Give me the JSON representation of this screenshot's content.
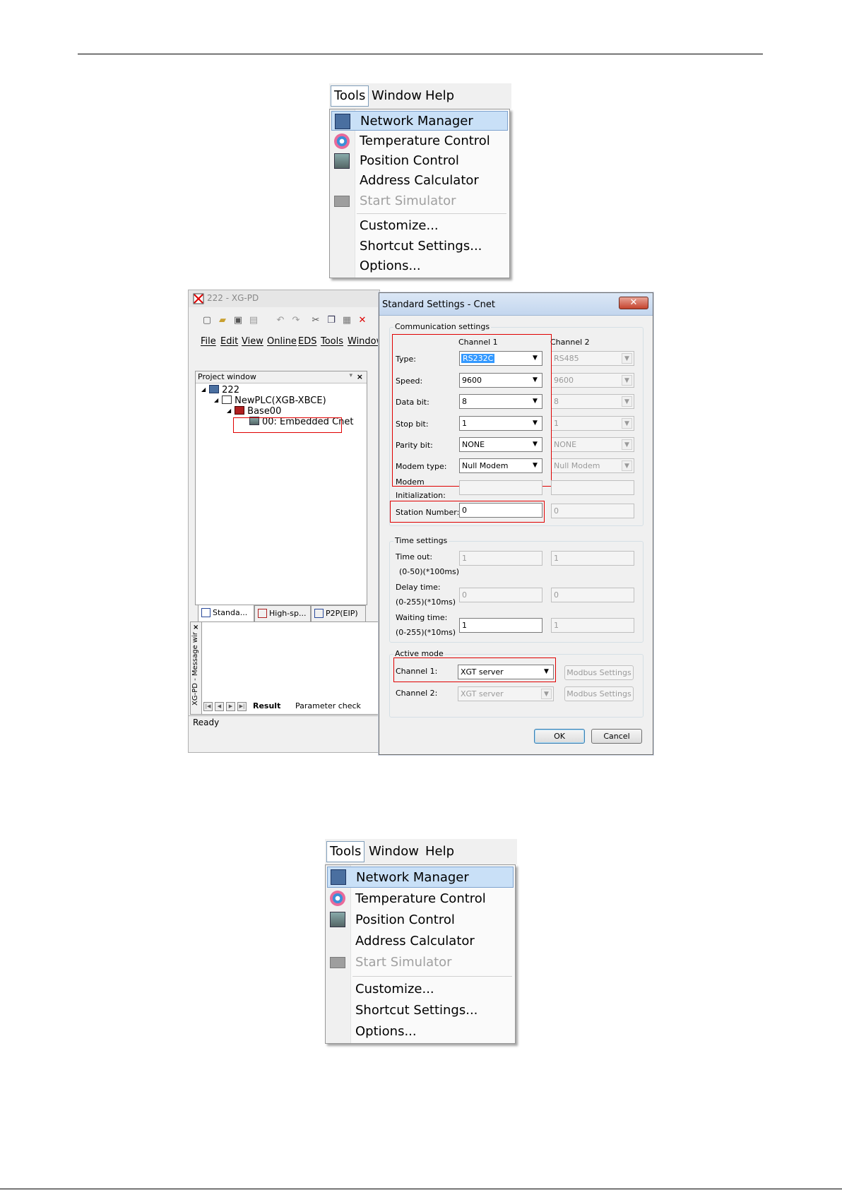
{
  "menu_top": {
    "bar": [
      "Tools",
      "Window",
      "Help"
    ],
    "items": [
      "Network Manager",
      "Temperature Control",
      "Position Control",
      "Address Calculator",
      "Start Simulator",
      "Customize...",
      "Shortcut Settings...",
      "Options..."
    ]
  },
  "menu_bottom": {
    "bar": [
      "Tools",
      "Window",
      "Help"
    ],
    "items": [
      "Network Manager",
      "Temperature Control",
      "Position Control",
      "Address Calculator",
      "Start Simulator",
      "Customize...",
      "Shortcut Settings...",
      "Options..."
    ]
  },
  "xgpd": {
    "title": "222 - XG-PD",
    "menu": [
      "File",
      "Edit",
      "View",
      "Online",
      "EDS",
      "Tools",
      "Window"
    ],
    "project_window": "Project window",
    "tree": [
      "222",
      "NewPLC(XGB-XBCE)",
      "Base00",
      "00: Embedded Cnet"
    ],
    "tabs": [
      "Standa...",
      "High-sp...",
      "P2P(EIP)"
    ],
    "message_window": "XG-PD - Message wir",
    "bottom_tabs": [
      "Result",
      "Parameter check"
    ],
    "status": "Ready"
  },
  "dialog": {
    "title": "Standard Settings - Cnet",
    "comm_group": "Communication settings",
    "channel1": "Channel 1",
    "channel2": "Channel 2",
    "labels": {
      "type": "Type:",
      "speed": "Speed:",
      "data_bit": "Data bit:",
      "stop_bit": "Stop bit:",
      "parity_bit": "Parity bit:",
      "modem_type": "Modem type:",
      "modem_init_1": "Modem",
      "modem_init_2": "Initialization:",
      "station_number": "Station Number:"
    },
    "ch1": {
      "type": "RS232C",
      "speed": "9600",
      "data_bit": "8",
      "stop_bit": "1",
      "parity_bit": "NONE",
      "modem_type": "Null Modem",
      "modem_init": "",
      "station_number": "0"
    },
    "ch2": {
      "type": "RS485",
      "speed": "9600",
      "data_bit": "8",
      "stop_bit": "1",
      "parity_bit": "NONE",
      "modem_type": "Null Modem",
      "modem_init": "",
      "station_number": "0"
    },
    "time_group": "Time settings",
    "time_labels": {
      "timeout_1": "Time out:",
      "timeout_2": "(0-50)(*100ms)",
      "delay_1": "Delay time:",
      "delay_2": "(0-255)(*10ms)",
      "waiting_1": "Waiting time:",
      "waiting_2": "(0-255)(*10ms)"
    },
    "time_ch1": {
      "timeout": "1",
      "delay": "0",
      "waiting": "1"
    },
    "time_ch2": {
      "timeout": "1",
      "delay": "0",
      "waiting": "1"
    },
    "active_group": "Active mode",
    "active": {
      "ch1_label": "Channel 1:",
      "ch1_value": "XGT server",
      "ch2_label": "Channel 2:",
      "ch2_value": "XGT server",
      "modbus_label": "Modbus Settings"
    },
    "ok": "OK",
    "cancel": "Cancel"
  },
  "colors": {
    "highlight": "#c9e0f7",
    "red_box": "#e00000",
    "selection": "#3399ff"
  }
}
